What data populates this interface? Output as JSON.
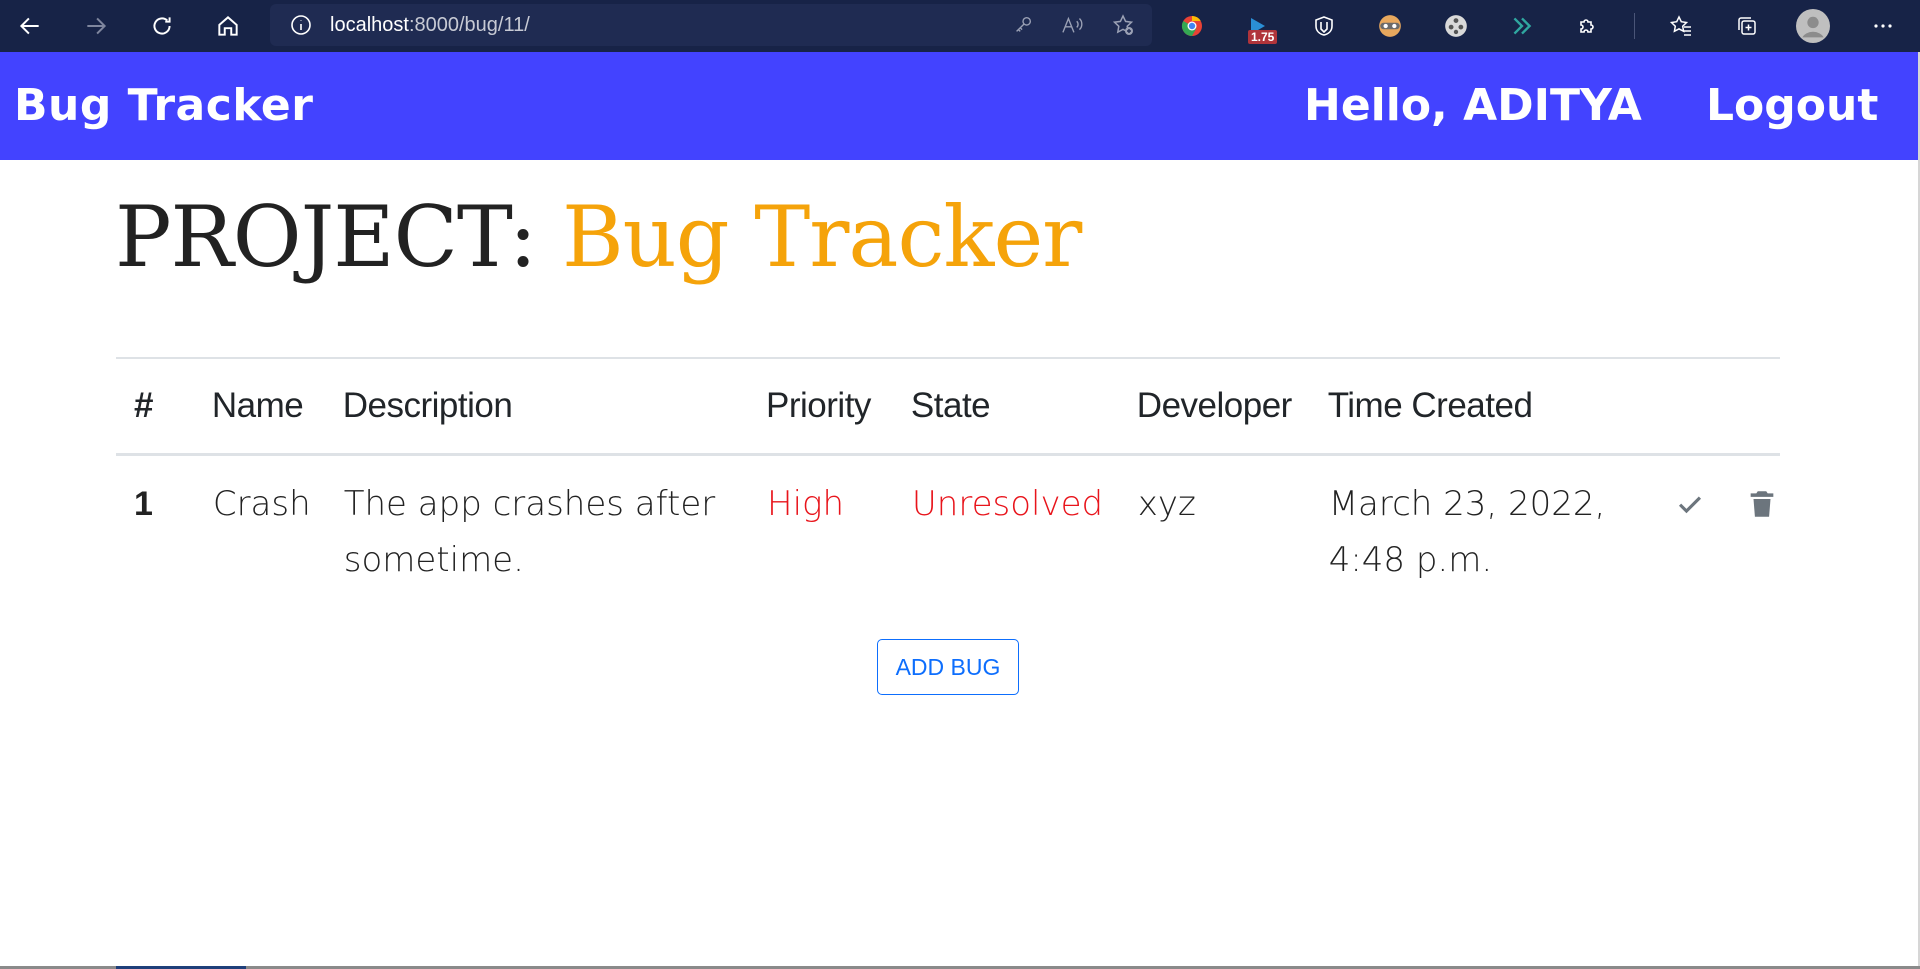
{
  "browser": {
    "url_host": "localhost",
    "url_rest": ":8000/bug/11/",
    "extension_badge": "1.75",
    "icons": [
      "back-icon",
      "forward-icon",
      "reload-icon",
      "home-icon",
      "info-icon",
      "key-icon",
      "read-aloud-icon",
      "favorite-add-icon",
      "extension-icon",
      "extension-badge-icon",
      "shield-icon",
      "mask-icon",
      "reel-icon",
      "chevrons-icon",
      "puzzle-icon",
      "favorites-icon",
      "collections-icon",
      "profile-icon",
      "more-icon"
    ]
  },
  "navbar": {
    "brand": "Bug Tracker",
    "greeting": "Hello, ADITYA",
    "logout": "Logout"
  },
  "project": {
    "prefix": "PROJECT:",
    "name": "Bug Tracker"
  },
  "table": {
    "headers": [
      "#",
      "Name",
      "Description",
      "Priority",
      "State",
      "Developer",
      "Time Created"
    ],
    "rows": [
      {
        "num": "1",
        "name": "Crash",
        "description": "The app crashes after sometime.",
        "priority": "High",
        "state": "Unresolved",
        "developer": "xyz",
        "time_created": "March 23, 2022, 4:48 p.m."
      }
    ]
  },
  "actions": {
    "add_bug": "ADD BUG"
  },
  "colors": {
    "navbar_bg": "#4343ff",
    "accent": "#f5a30a",
    "danger": "#e8141b",
    "primary": "#0d6efd"
  }
}
